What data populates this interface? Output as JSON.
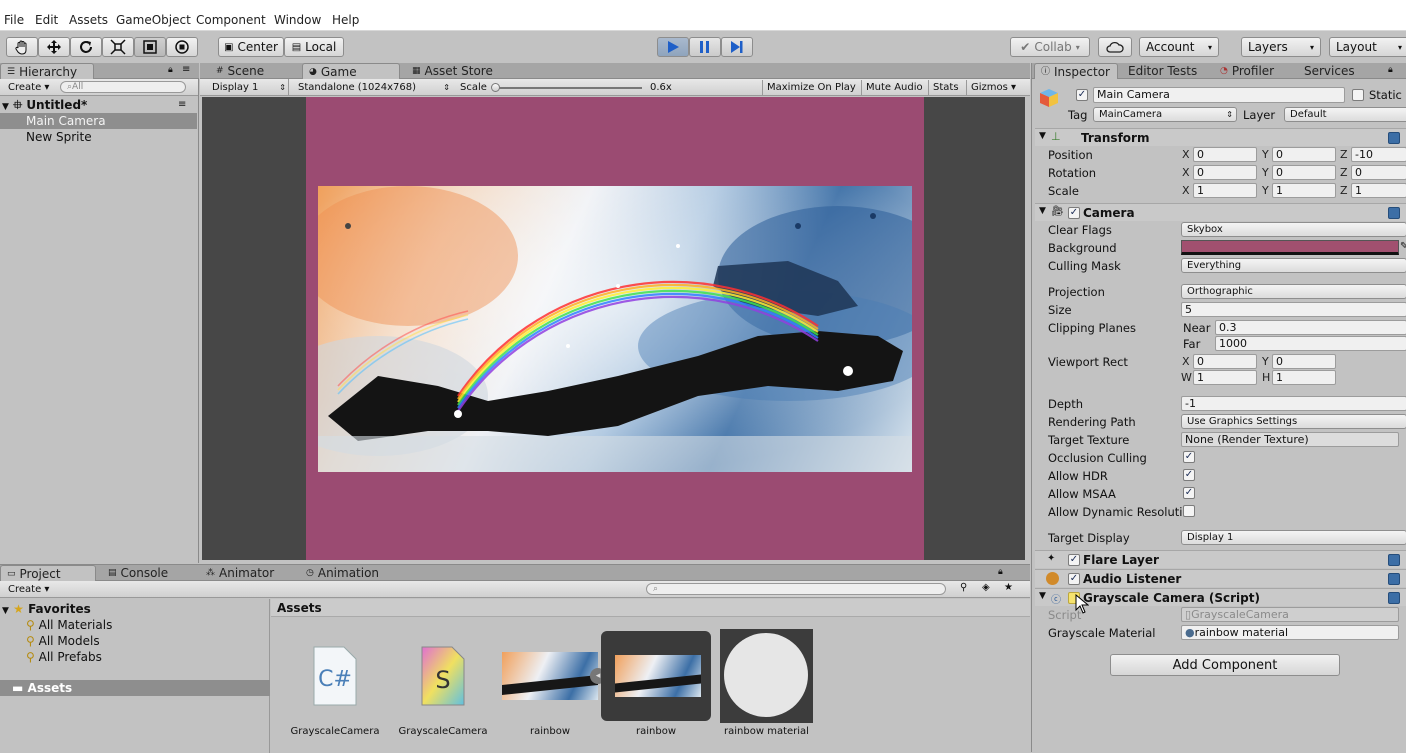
{
  "menu": [
    "File",
    "Edit",
    "Assets",
    "GameObject",
    "Component",
    "Window",
    "Help"
  ],
  "toolbar": {
    "center_label": "Center",
    "local_label": "Local",
    "collab_label": "Collab",
    "account_label": "Account",
    "layers_label": "Layers",
    "layout_label": "Layout"
  },
  "hierarchy": {
    "tab": "Hierarchy",
    "create_label": "Create",
    "search_placeholder": "All",
    "scene_name": "Untitled*",
    "items": [
      "Main Camera",
      "New Sprite"
    ]
  },
  "center_tabs": [
    "Scene",
    "Game",
    "Asset Store"
  ],
  "game_bar": {
    "display": "Display 1",
    "resolution": "Standalone (1024x768)",
    "scale_label": "Scale",
    "scale_value": "0.6x",
    "maximize": "Maximize On Play",
    "mute": "Mute Audio",
    "stats": "Stats",
    "gizmos": "Gizmos"
  },
  "colors": {
    "game_background": "#9b4b72",
    "background_swatch": "#a1506f",
    "accent_blue": "#3c6ea6"
  },
  "inspector": {
    "tabs": [
      "Inspector",
      "Editor Tests",
      "Profiler",
      "Services"
    ],
    "object_name": "Main Camera",
    "static_label": "Static",
    "tag_label": "Tag",
    "tag_value": "MainCamera",
    "layer_label": "Layer",
    "layer_value": "Default",
    "transform": {
      "title": "Transform",
      "rows": [
        {
          "label": "Position",
          "x": "0",
          "y": "0",
          "z": "-10"
        },
        {
          "label": "Rotation",
          "x": "0",
          "y": "0",
          "z": "0"
        },
        {
          "label": "Scale",
          "x": "1",
          "y": "1",
          "z": "1"
        }
      ]
    },
    "camera": {
      "title": "Camera",
      "clear_flags_label": "Clear Flags",
      "clear_flags": "Skybox",
      "background_label": "Background",
      "culling_label": "Culling Mask",
      "culling": "Everything",
      "projection_label": "Projection",
      "projection": "Orthographic",
      "size_label": "Size",
      "size": "5",
      "clipping_label": "Clipping Planes",
      "near_label": "Near",
      "near": "0.3",
      "far_label": "Far",
      "far": "1000",
      "viewport_label": "Viewport Rect",
      "vx": "0",
      "vy": "0",
      "vw": "1",
      "vh": "1",
      "depth_label": "Depth",
      "depth": "-1",
      "rendering_label": "Rendering Path",
      "rendering": "Use Graphics Settings",
      "target_texture_label": "Target Texture",
      "target_texture": "None (Render Texture)",
      "occlusion_label": "Occlusion Culling",
      "hdr_label": "Allow HDR",
      "msaa_label": "Allow MSAA",
      "dynamic_label": "Allow Dynamic Resoluti",
      "target_display_label": "Target Display",
      "target_display": "Display 1"
    },
    "flare_layer": "Flare Layer",
    "audio_listener": "Audio Listener",
    "grayscale": {
      "title": "Grayscale Camera (Script)",
      "script_label": "Script",
      "script_value": "GrayscaleCamera",
      "material_label": "Grayscale Material",
      "material_value": "rainbow material"
    },
    "add_component": "Add Component"
  },
  "bottom_tabs": [
    "Project",
    "Console",
    "Animator",
    "Animation"
  ],
  "project": {
    "create_label": "Create",
    "favorites_label": "Favorites",
    "favorites": [
      "All Materials",
      "All Models",
      "All Prefabs"
    ],
    "assets_folder": "Assets",
    "assets_header": "Assets",
    "assets": [
      "GrayscaleCamera",
      "GrayscaleCamera",
      "rainbow",
      "rainbow",
      "rainbow material"
    ]
  }
}
